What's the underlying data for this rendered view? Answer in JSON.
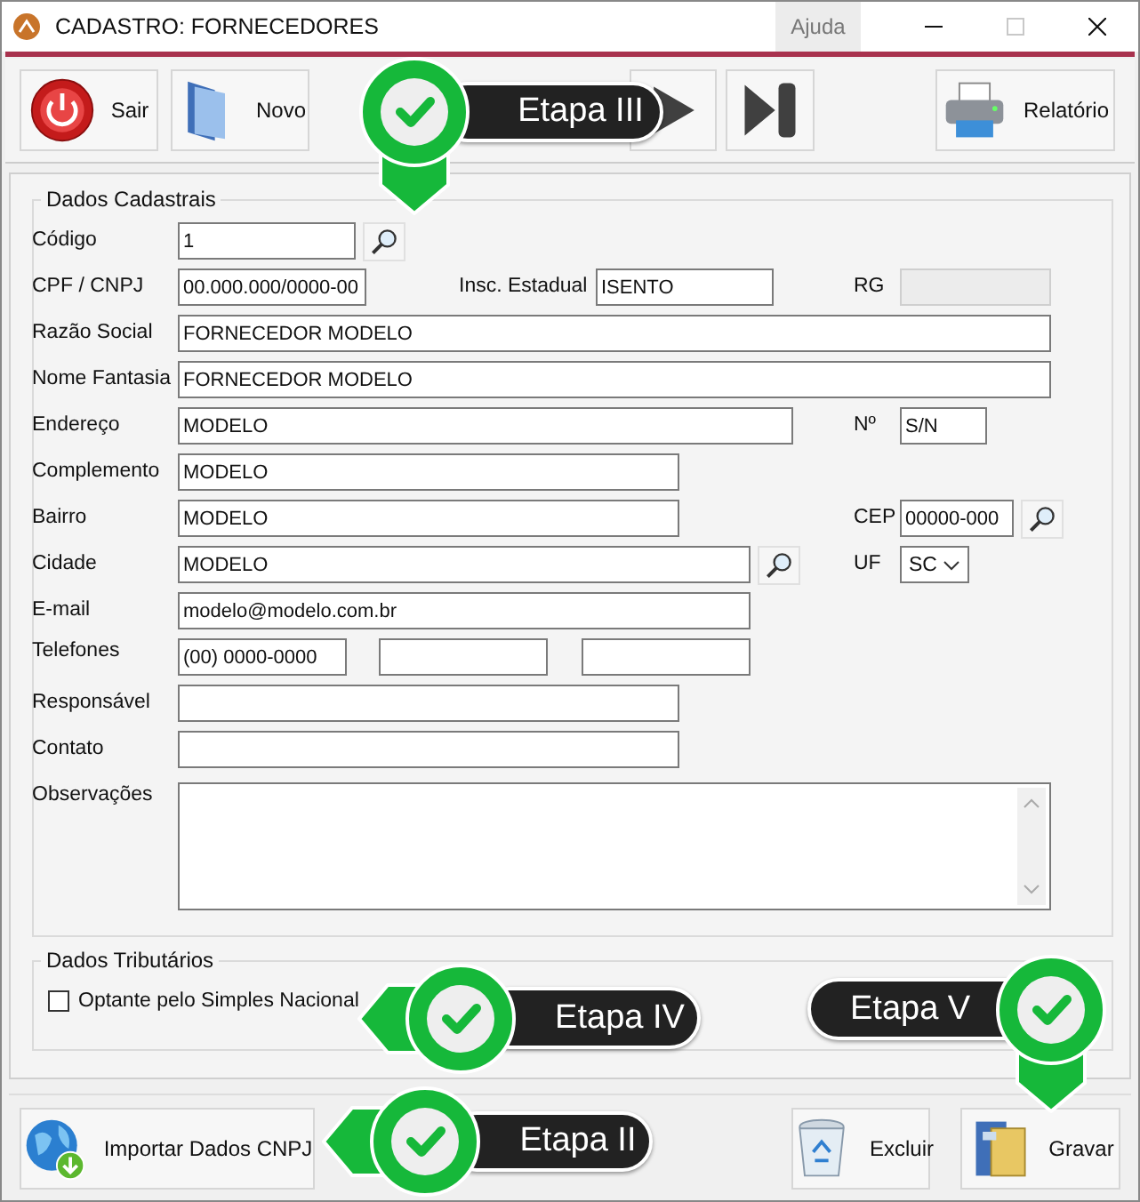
{
  "window": {
    "title": "CADASTRO: FORNECEDORES",
    "menu": [
      "Ajuda"
    ]
  },
  "toolbar": [
    {
      "kind": "exit",
      "label": "Sair"
    },
    {
      "kind": "new",
      "label": "Novo"
    },
    {
      "kind": "next"
    },
    {
      "kind": "last"
    },
    {
      "kind": "report",
      "label": "Relatório"
    }
  ],
  "dados_cadastrais": {
    "title": "Dados Cadastrais",
    "fields": [
      {
        "label": "Código",
        "kind": "lookup",
        "value": "1",
        "disabled": false
      },
      {
        "label": "CPF / CNPJ",
        "kind": "input",
        "value": "00.000.000/0000-00",
        "disabled": false
      },
      {
        "label": "Insc. Estadual",
        "kind": "input",
        "value": "ISENTO",
        "disabled": false
      },
      {
        "label": "RG",
        "kind": "input",
        "disabled": true
      },
      {
        "label": "Razão Social",
        "kind": "input",
        "value": "FORNECEDOR MODELO",
        "disabled": false
      },
      {
        "label": "Nome Fantasia",
        "kind": "input",
        "value": "FORNECEDOR MODELO",
        "disabled": false
      },
      {
        "label": "Endereço",
        "kind": "input",
        "value": "MODELO",
        "disabled": false
      },
      {
        "label": "Nº",
        "kind": "input",
        "value": "S/N",
        "disabled": false
      },
      {
        "label": "Complemento",
        "kind": "input",
        "value": "MODELO",
        "disabled": false
      },
      {
        "label": "Bairro",
        "kind": "input",
        "value": "MODELO",
        "disabled": false
      },
      {
        "label": "CEP",
        "kind": "lookup",
        "value": "00000-000",
        "disabled": false
      },
      {
        "label": "Cidade",
        "kind": "lookup",
        "value": "MODELO",
        "disabled": false
      },
      {
        "label": "UF",
        "kind": "select",
        "value": "SC"
      },
      {
        "label": "E-mail",
        "kind": "input",
        "value": "modelo@modelo.com.br",
        "disabled": false
      },
      {
        "label": "Telefones",
        "kind": "triple",
        "value": "(00) 0000-0000",
        "disabled": false
      },
      {
        "label": "Responsável",
        "kind": "input",
        "disabled": false
      },
      {
        "label": "Contato",
        "kind": "input",
        "disabled": false
      },
      {
        "label": "Observações",
        "kind": "textarea"
      }
    ]
  },
  "dados_tributarios": {
    "title": "Dados Tributários",
    "options": [
      {
        "label": "Optante pelo Simples Nacional",
        "checked": false
      }
    ]
  },
  "footer": [
    {
      "kind": "import",
      "label": "Importar Dados CNPJ"
    },
    {
      "kind": "delete",
      "label": "Excluir"
    },
    {
      "kind": "save",
      "label": "Gravar"
    }
  ],
  "callouts": [
    {
      "label": "Etapa III",
      "kind": "down"
    },
    {
      "label": "Etapa IV",
      "kind": "left"
    },
    {
      "label": "Etapa V",
      "kind": "down"
    },
    {
      "label": "Etapa II",
      "kind": "left"
    }
  ]
}
